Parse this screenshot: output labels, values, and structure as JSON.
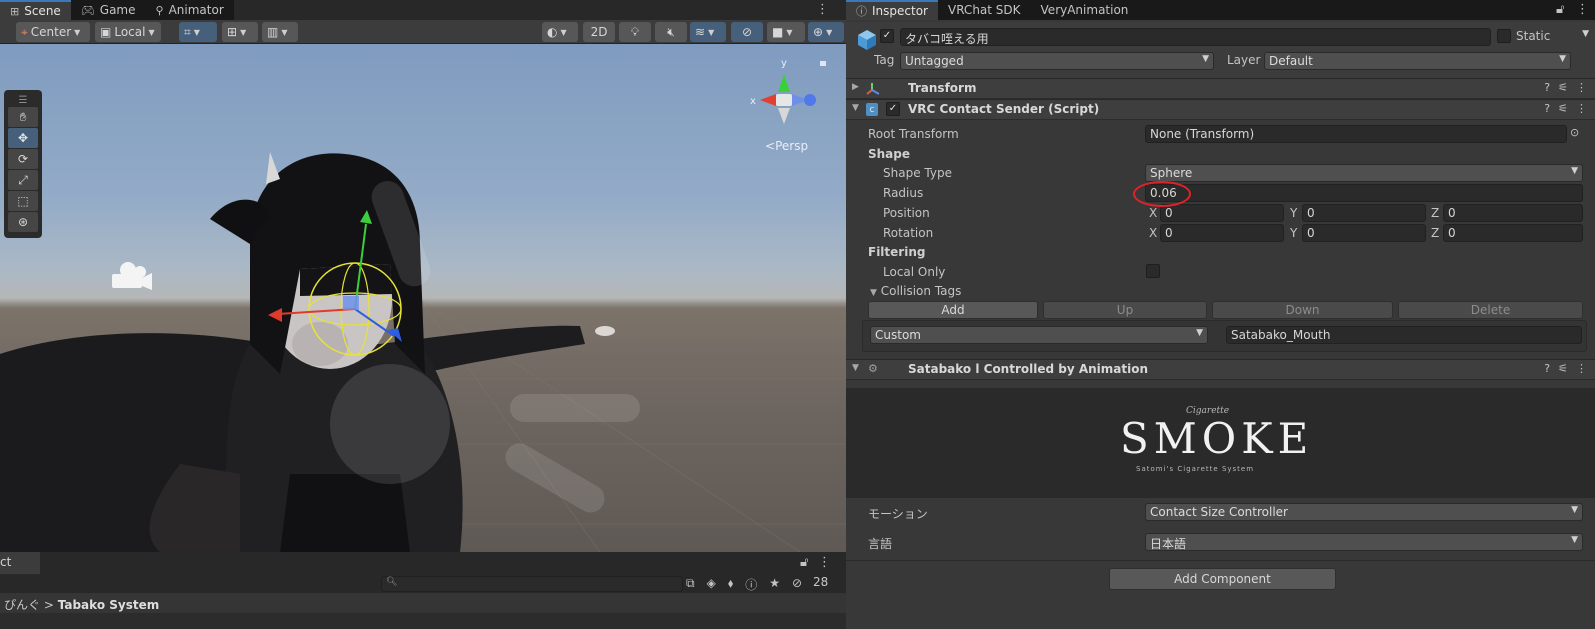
{
  "scene_tabs": [
    {
      "icon": "grid-icon",
      "label": "Scene",
      "active": true
    },
    {
      "icon": "gamepad-icon",
      "label": "Game",
      "active": false
    },
    {
      "icon": "animator-icon",
      "label": "Animator",
      "active": false
    }
  ],
  "scene_toolbar": {
    "pivot_mode": "Center",
    "pivot_rotation": "Local",
    "mode_2d": "2D"
  },
  "viewport": {
    "gizmo": {
      "y": "y",
      "x": "x",
      "projection": "Persp"
    }
  },
  "project": {
    "tab_label": "ct",
    "breadcrumb_prev": "ぴんぐ",
    "breadcrumb_sep": ">",
    "breadcrumb_current": "Tabako System",
    "hidden_count": "28"
  },
  "inspector_tabs": [
    {
      "icon": "info-icon",
      "label": "Inspector",
      "active": true
    },
    {
      "label": "VRChat SDK",
      "active": false
    },
    {
      "label": "VeryAnimation",
      "active": false
    }
  ],
  "gameobject": {
    "name": "タバコ咥える用",
    "static_label": "Static",
    "tag_label": "Tag",
    "tag_value": "Untagged",
    "layer_label": "Layer",
    "layer_value": "Default"
  },
  "components": {
    "transform": {
      "name": "Transform"
    },
    "contact_sender": {
      "name": "VRC Contact Sender (Script)",
      "root_transform_label": "Root Transform",
      "root_transform_value": "None (Transform)",
      "shape_header": "Shape",
      "shape_type_label": "Shape Type",
      "shape_type_value": "Sphere",
      "radius_label": "Radius",
      "radius_value": "0.06",
      "position_label": "Position",
      "position": {
        "x": "0",
        "y": "0",
        "z": "0"
      },
      "rotation_label": "Rotation",
      "rotation": {
        "x": "0",
        "y": "0",
        "z": "0"
      },
      "axis_x": "X",
      "axis_y": "Y",
      "axis_z": "Z",
      "filtering_header": "Filtering",
      "local_only_label": "Local Only",
      "collision_tags_label": "Collision Tags",
      "buttons": {
        "add": "Add",
        "up": "Up",
        "down": "Down",
        "delete": "Delete"
      },
      "tag_type": "Custom",
      "tag_value": "Satabako_Mouth"
    },
    "satabako": {
      "name": "Satabako l Controlled by Animation",
      "logo_script": "Cigarette",
      "logo_word": "SMOKE",
      "logo_tagline": "Satomi's Cigarette System",
      "motion_label": "モーション",
      "motion_value": "Contact Size Controller",
      "language_label": "言語",
      "language_value": "日本語"
    }
  },
  "add_component": "Add Component",
  "colors": {
    "accent_blue": "#46607c",
    "annotation_red": "#e0222a",
    "panel_dark": "#383838"
  }
}
